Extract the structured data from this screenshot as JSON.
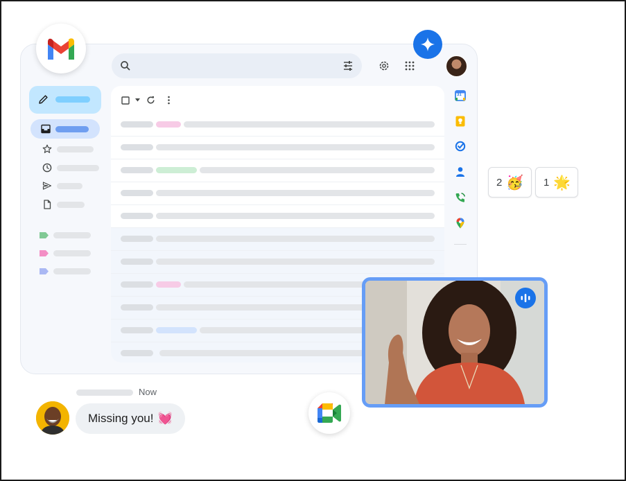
{
  "colors": {
    "accent": "#1a73e8",
    "compose_bg": "#c2e7ff",
    "inbox_selected_bg": "#d3e3fd",
    "label_green": "#81c995",
    "label_pink": "#f38ec5",
    "label_purple": "#aab8f3",
    "video_border": "#669df6"
  },
  "icons": {
    "logo": "gmail-logo",
    "search": "search-icon",
    "filter": "tune-icon",
    "settings": "gear-icon",
    "apps": "apps-grid-icon",
    "gemini": "sparkle-icon",
    "compose": "pencil-icon",
    "inbox": "inbox-icon",
    "starred": "star-icon",
    "snoozed": "clock-icon",
    "sent": "send-icon",
    "drafts": "file-icon",
    "labels": [
      "label-icon",
      "label-icon",
      "label-icon"
    ],
    "toolbar": [
      "checkbox-icon",
      "dropdown-arrow-icon",
      "refresh-icon",
      "more-vert-icon"
    ],
    "side_apps": [
      "calendar-icon",
      "keep-icon",
      "tasks-icon",
      "contacts-icon",
      "voice-icon",
      "maps-icon"
    ],
    "meet": "google-meet-icon",
    "audio": "audio-level-icon"
  },
  "side_apps": {
    "calendar_day": "31"
  },
  "reactions": [
    {
      "count": "2",
      "emoji": "🥳"
    },
    {
      "count": "1",
      "emoji": "🌟"
    }
  ],
  "chat": {
    "time": "Now",
    "message": "Missing you!",
    "emoji": "💓"
  }
}
